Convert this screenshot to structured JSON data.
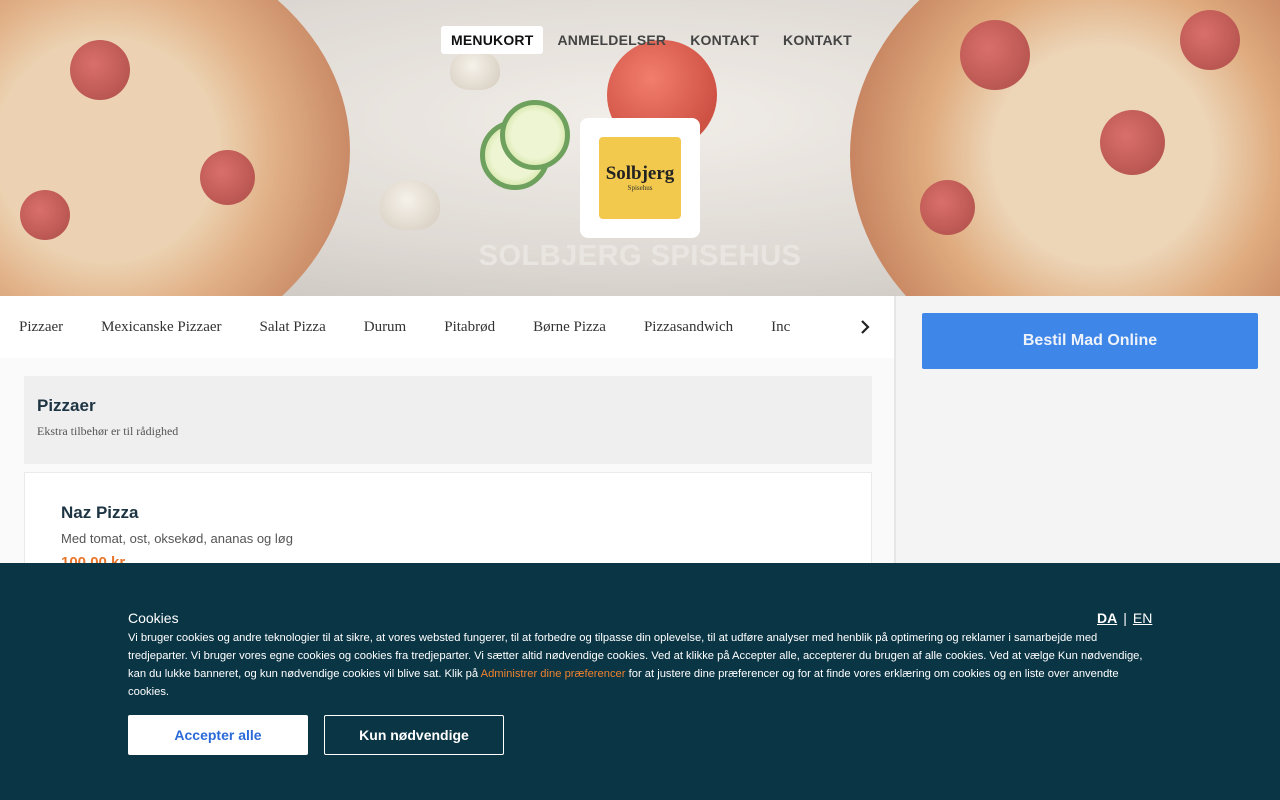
{
  "header": {
    "nav": [
      {
        "label": "MENUKORT",
        "active": true
      },
      {
        "label": "ANMELDELSER",
        "active": false
      },
      {
        "label": "KONTAKT",
        "active": false
      },
      {
        "label": "KONTAKT",
        "active": false
      }
    ],
    "logo": {
      "line1": "Solbjerg",
      "line2": "Spisehus"
    },
    "restaurant_name": "SOLBJERG SPISEHUS"
  },
  "categories": [
    "Pizzaer",
    "Mexicanske Pizzaer",
    "Salat Pizza",
    "Durum",
    "Pitabrød",
    "Børne Pizza",
    "Pizzasandwich",
    "Inc"
  ],
  "section": {
    "title": "Pizzaer",
    "subtitle": "Ekstra tilbehør er til rådighed"
  },
  "items": [
    {
      "name": "Naz Pizza",
      "description": "Med tomat, ost, oksekød, ananas og løg",
      "price": "100,00 kr."
    }
  ],
  "sidebar": {
    "order_label": "Bestil Mad Online"
  },
  "cookie": {
    "title": "Cookies",
    "lang_da": "DA",
    "lang_sep": "|",
    "lang_en": "EN",
    "text_before_link": "Vi bruger cookies og andre teknologier til at sikre, at vores websted fungerer, til at forbedre og tilpasse din oplevelse, til at udføre analyser med henblik på optimering og reklamer i samarbejde med tredjeparter. Vi bruger vores egne cookies og cookies fra tredjeparter. Vi sætter altid nødvendige cookies. Ved at klikke på Accepter alle, accepterer du brugen af alle cookies. Ved at vælge Kun nødvendige, kan du lukke banneret, og kun nødvendige cookies vil blive sat. Klik på ",
    "link_text": "Administrer dine præferencer",
    "text_after_link": " for at justere dine præferencer og for at finde vores erklæring om cookies og en liste over anvendte cookies.",
    "accept_label": "Accepter alle",
    "necessary_label": "Kun nødvendige"
  },
  "colors": {
    "banner_bg": "#0a3545",
    "accent_orange": "#f0822e",
    "order_button": "#3e86e8"
  }
}
